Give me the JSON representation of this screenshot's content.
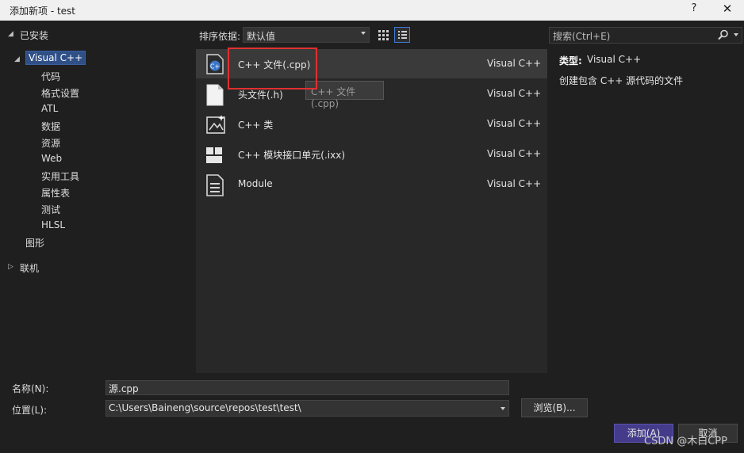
{
  "window": {
    "title": "添加新项 - test",
    "help_label": "?",
    "close_label": "✕"
  },
  "tree": {
    "installed_label": "已安装",
    "visual_cpp_label": "Visual C++",
    "children": [
      "代码",
      "格式设置",
      "ATL",
      "数据",
      "资源",
      "Web",
      "实用工具",
      "属性表",
      "测试",
      "HLSL"
    ],
    "graphics_label": "图形",
    "online_label": "联机"
  },
  "sort": {
    "label": "排序依据:",
    "value": "默认值"
  },
  "templates": [
    {
      "name": "C++ 文件(.cpp)",
      "lang": "Visual C++",
      "icon": "cpp-file-icon"
    },
    {
      "name": "头文件(.h)",
      "lang": "Visual C++",
      "icon": "header-file-icon"
    },
    {
      "name": "C++ 类",
      "lang": "Visual C++",
      "icon": "cpp-class-icon"
    },
    {
      "name": "C++ 模块接口单元(.ixx)",
      "lang": "Visual C++",
      "icon": "module-interface-icon"
    },
    {
      "name": "Module",
      "lang": "Visual C++",
      "icon": "module-def-file-icon"
    }
  ],
  "tooltip": "C++ 文件(.cpp)",
  "search": {
    "placeholder": "搜索(Ctrl+E)"
  },
  "details": {
    "type_label": "类型:",
    "type_value": "Visual C++",
    "description": "创建包含 C++ 源代码的文件"
  },
  "form": {
    "name_label": "名称(N):",
    "name_value": "源.cpp",
    "location_label": "位置(L):",
    "location_value": "C:\\Users\\Baineng\\source\\repos\\test\\test\\",
    "browse_label": "浏览(B)...",
    "add_label": "添加(A)",
    "cancel_label": "取消"
  },
  "watermark": "CSDN @木白CPP",
  "colors": {
    "selection": "#2f4f87",
    "highlight_border": "#e03030",
    "primary_button": "#443c8a"
  }
}
